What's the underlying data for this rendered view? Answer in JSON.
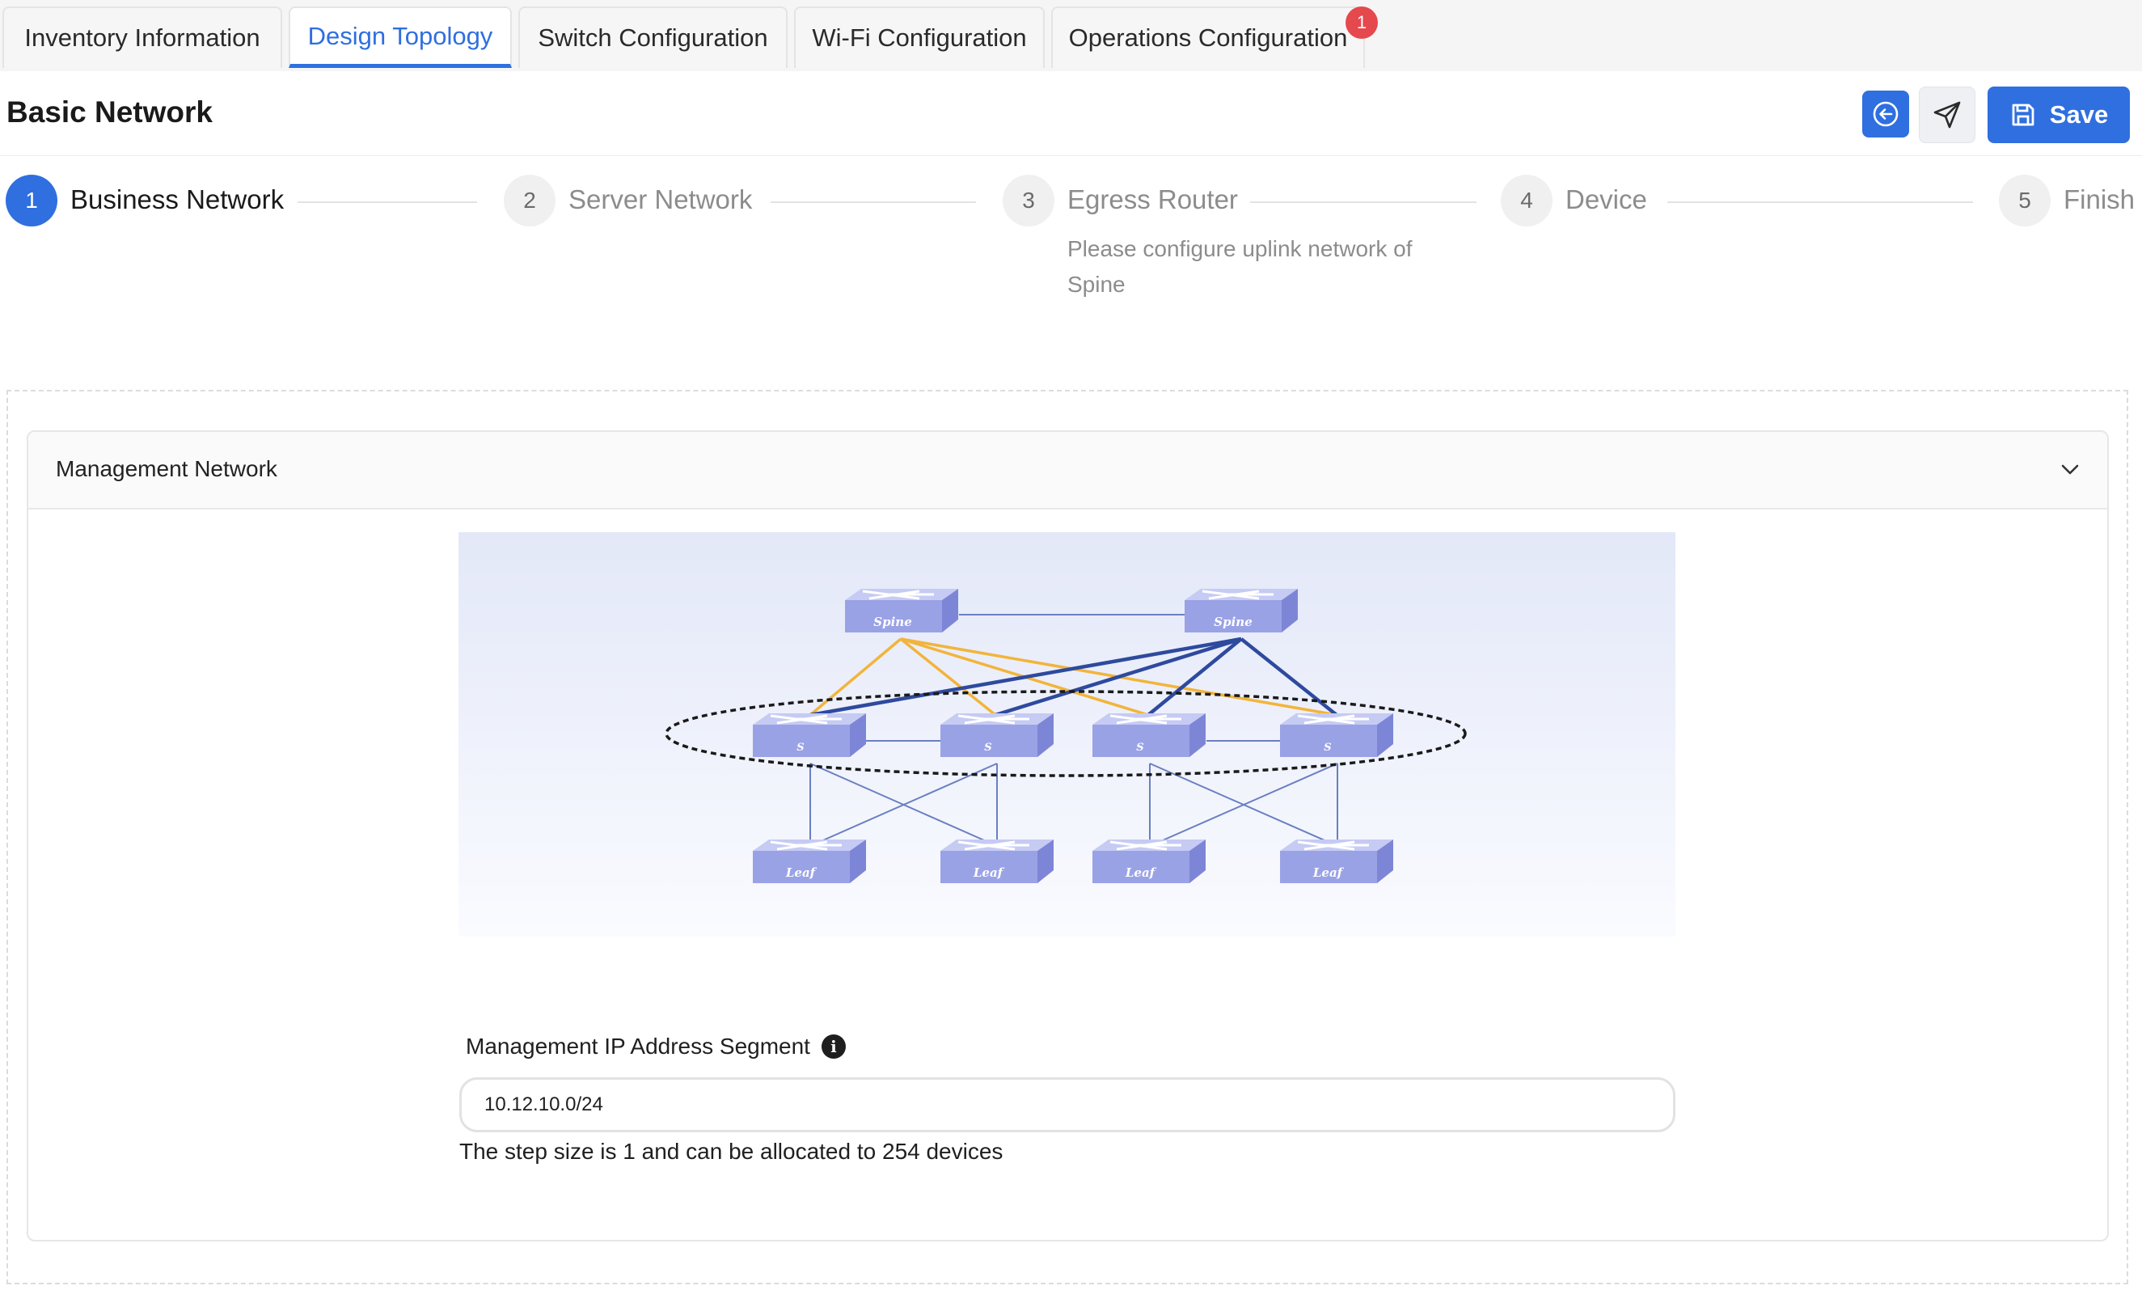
{
  "tabs": [
    {
      "label": "Inventory Information"
    },
    {
      "label": "Design Topology"
    },
    {
      "label": "Switch Configuration"
    },
    {
      "label": "Wi-Fi Configuration"
    },
    {
      "label": "Operations Configuration",
      "badge": "1"
    }
  ],
  "header": {
    "title": "Basic Network",
    "save_label": "Save",
    "icons": [
      "back-circle-icon",
      "send-icon",
      "save-disk-icon"
    ]
  },
  "steps": [
    {
      "number": "1",
      "label": "Business Network",
      "state": "active"
    },
    {
      "number": "2",
      "label": "Server Network",
      "state": "pending"
    },
    {
      "number": "3",
      "label": "Egress Router",
      "state": "pending",
      "description": "Please configure uplink network of Spine"
    },
    {
      "number": "4",
      "label": "Device",
      "state": "pending"
    },
    {
      "number": "5",
      "label": "Finish",
      "state": "pending"
    }
  ],
  "panel": {
    "title": "Management Network",
    "topology": {
      "spine_label": "Spine",
      "switch_label": "S",
      "leaf_label": "Leaf"
    },
    "field_label": "Management IP Address Segment",
    "ip_value": "10.12.10.0/24",
    "help_text": "The step size is 1 and can be allocated to 254 devices"
  },
  "colors": {
    "accent": "#2f6fe0",
    "badge": "#e5484d",
    "switch_fill": "#9aa2e6",
    "dark_link": "#2e4a9e",
    "yellow_link": "#f2b43a"
  }
}
